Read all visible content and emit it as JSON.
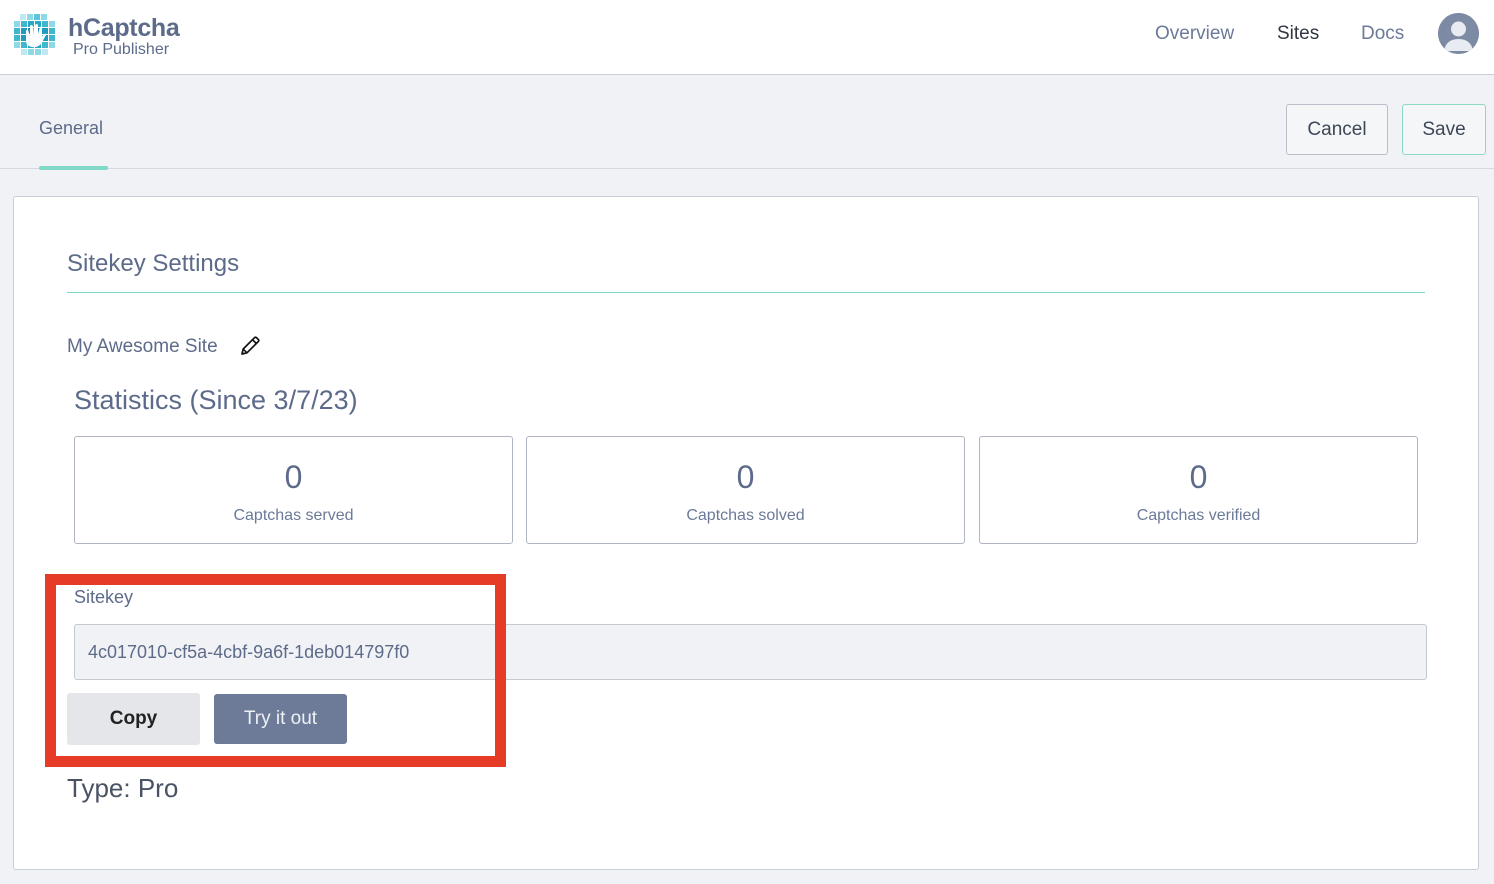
{
  "header": {
    "brand_name": "hCaptcha",
    "brand_sub": "Pro Publisher",
    "nav": [
      {
        "label": "Overview",
        "active": false
      },
      {
        "label": "Sites",
        "active": true
      },
      {
        "label": "Docs",
        "active": false
      }
    ],
    "avatar_icon": "user-avatar-icon"
  },
  "subheader": {
    "tab_general": "General",
    "cancel_label": "Cancel",
    "save_label": "Save"
  },
  "settings": {
    "title": "Sitekey Settings",
    "site_name": "My Awesome Site",
    "edit_icon": "pencil-icon",
    "stats_title": "Statistics (Since 3/7/23)",
    "stats": [
      {
        "value": "0",
        "label": "Captchas served"
      },
      {
        "value": "0",
        "label": "Captchas solved"
      },
      {
        "value": "0",
        "label": "Captchas verified"
      }
    ],
    "sitekey_label": "Sitekey",
    "sitekey_value": "4c017010-cf5a-4cbf-9a6f-1deb014797f0",
    "copy_label": "Copy",
    "try_label": "Try it out",
    "type_label": "Type: Pro"
  },
  "colors": {
    "accent": "#7fd9c6",
    "brand": "#5d6b8a",
    "highlight": "#e63b26",
    "try_button": "#6d7b99"
  }
}
